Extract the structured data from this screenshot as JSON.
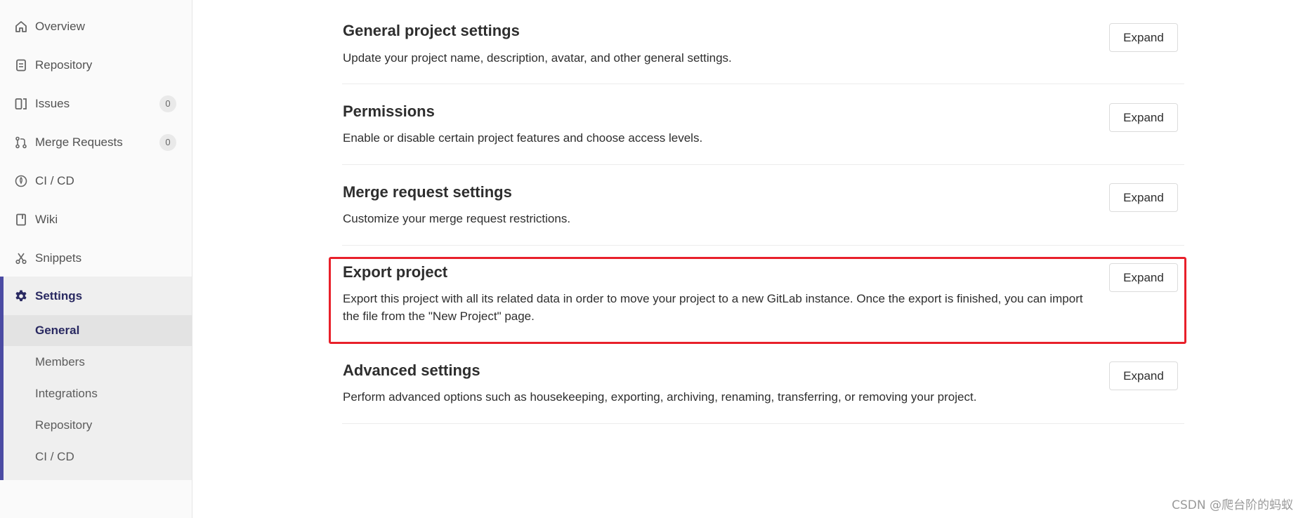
{
  "sidebar": {
    "items": [
      {
        "label": "Overview",
        "icon": "home-icon"
      },
      {
        "label": "Repository",
        "icon": "document-icon"
      },
      {
        "label": "Issues",
        "icon": "issues-icon",
        "count": "0"
      },
      {
        "label": "Merge Requests",
        "icon": "merge-request-icon",
        "count": "0"
      },
      {
        "label": "CI / CD",
        "icon": "rocket-icon"
      },
      {
        "label": "Wiki",
        "icon": "book-icon"
      },
      {
        "label": "Snippets",
        "icon": "scissors-icon"
      }
    ],
    "settings": {
      "label": "Settings",
      "icon": "gear-icon",
      "subitems": [
        "General",
        "Members",
        "Integrations",
        "Repository",
        "CI / CD"
      ],
      "active": "General"
    }
  },
  "sections": [
    {
      "title": "General project settings",
      "description": "Update your project name, description, avatar, and other general settings.",
      "button": "Expand"
    },
    {
      "title": "Permissions",
      "description": "Enable or disable certain project features and choose access levels.",
      "button": "Expand"
    },
    {
      "title": "Merge request settings",
      "description": "Customize your merge request restrictions.",
      "button": "Expand"
    },
    {
      "title": "Export project",
      "description": "Export this project with all its related data in order to move your project to a new GitLab instance. Once the export is finished, you can import the file from the \"New Project\" page.",
      "button": "Expand"
    },
    {
      "title": "Advanced settings",
      "description": "Perform advanced options such as housekeeping, exporting, archiving, renaming, transferring, or removing your project.",
      "button": "Expand"
    }
  ],
  "colors": {
    "accent": "#4b4ba3",
    "highlight": "#e8202a"
  },
  "watermark": "CSDN @爬台阶的蚂蚁"
}
